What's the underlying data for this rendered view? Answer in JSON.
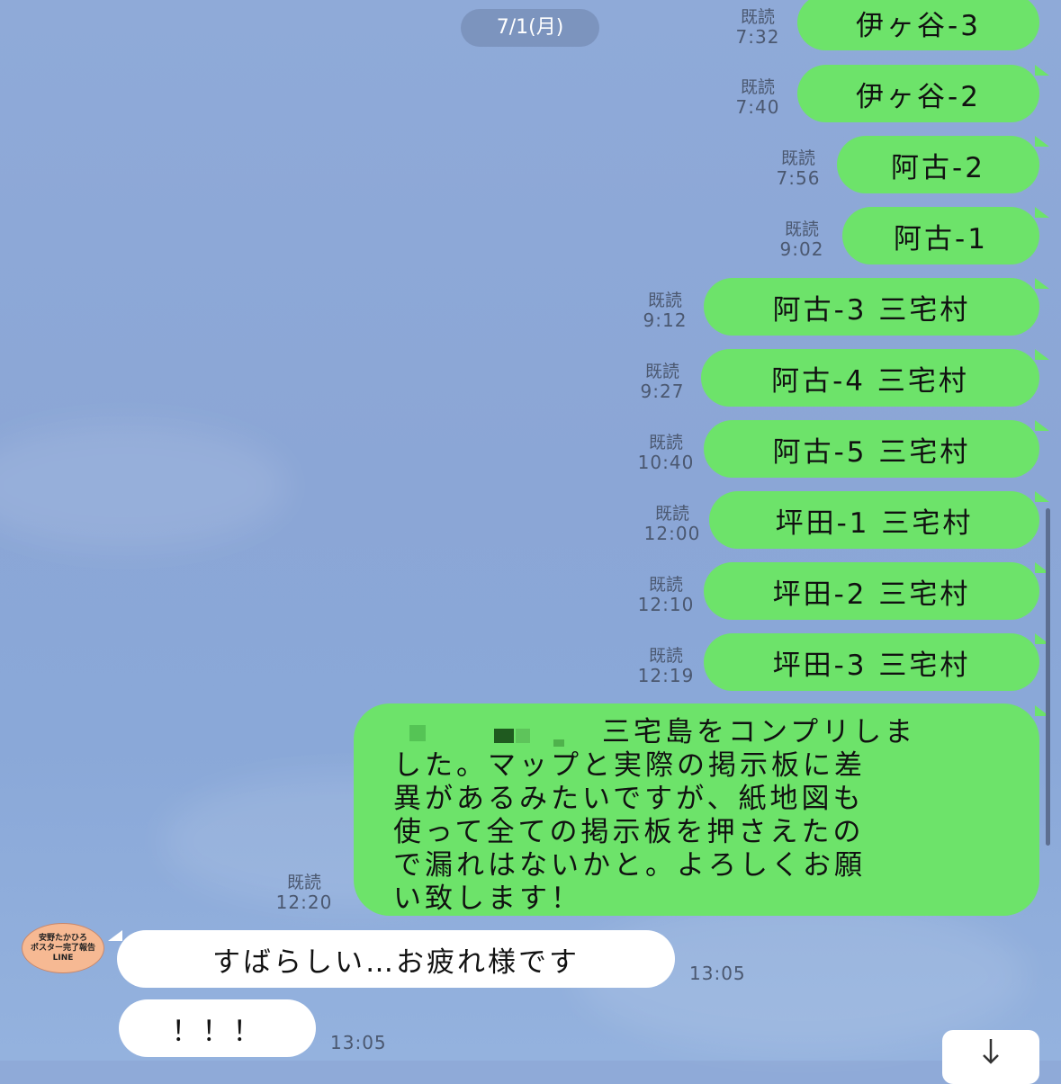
{
  "date_label": "7/1(月)",
  "sent_messages": [
    {
      "text": "伊ヶ谷-3",
      "read": "既読",
      "time": "7:32"
    },
    {
      "text": "伊ヶ谷-2",
      "read": "既読",
      "time": "7:40"
    },
    {
      "text": "阿古-2",
      "read": "既読",
      "time": "7:56"
    },
    {
      "text": "阿古-1",
      "read": "既読",
      "time": "9:02"
    },
    {
      "text": "阿古-3 三宅村",
      "read": "既読",
      "time": "9:12"
    },
    {
      "text": "阿古-4 三宅村",
      "read": "既読",
      "time": "9:27"
    },
    {
      "text": "阿古-5 三宅村",
      "read": "既読",
      "time": "10:40"
    },
    {
      "text": "坪田-1 三宅村",
      "read": "既読",
      "time": "12:00"
    },
    {
      "text": "坪田-2 三宅村",
      "read": "既読",
      "time": "12:10"
    },
    {
      "text": "坪田-3 三宅村",
      "read": "既読",
      "time": "12:19"
    }
  ],
  "long_message": {
    "lines": [
      "三宅島をコンプリしま",
      "した。マップと実際の掲示板に差",
      "異があるみたいですが、紙地図も",
      "使って全ての掲示板を押さえたの",
      "で漏れはないかと。よろしくお願",
      "い致します！"
    ],
    "read": "既読",
    "time": "12:20"
  },
  "avatar_text": [
    "安野たかひろ",
    "ポスター完了報告",
    "LINE"
  ],
  "received_messages": [
    {
      "text": "すばらしい…お疲れ様です",
      "time": "13:05"
    },
    {
      "text": "！！！",
      "time": "13:05"
    }
  ],
  "colors": {
    "sent_bubble": "#6de36a",
    "received_bubble": "#ffffff",
    "background": "#8aa8d8"
  },
  "icons": {
    "scroll_down": "arrow-down-icon"
  }
}
